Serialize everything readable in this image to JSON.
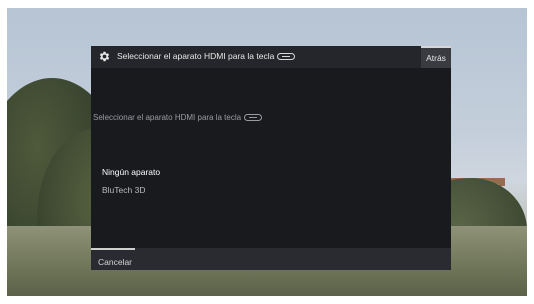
{
  "dialog": {
    "title": "Seleccionar el aparato HDMI para la tecla",
    "back_label": "Atrás",
    "subtitle": "Seleccionar el aparato HDMI para la tecla",
    "options": [
      {
        "label": "Ningún aparato",
        "selected": true
      },
      {
        "label": "BluTech 3D",
        "selected": false
      }
    ],
    "cancel_label": "Cancelar"
  },
  "icons": {
    "settings": "gear-icon",
    "key": "remote-key-icon"
  },
  "colors": {
    "dialog_bg": "#191a1e",
    "header_bg": "#25262b",
    "back_button_bg": "#3a3b40",
    "text_primary": "#ffffff",
    "text_secondary": "#9a9aa0"
  }
}
